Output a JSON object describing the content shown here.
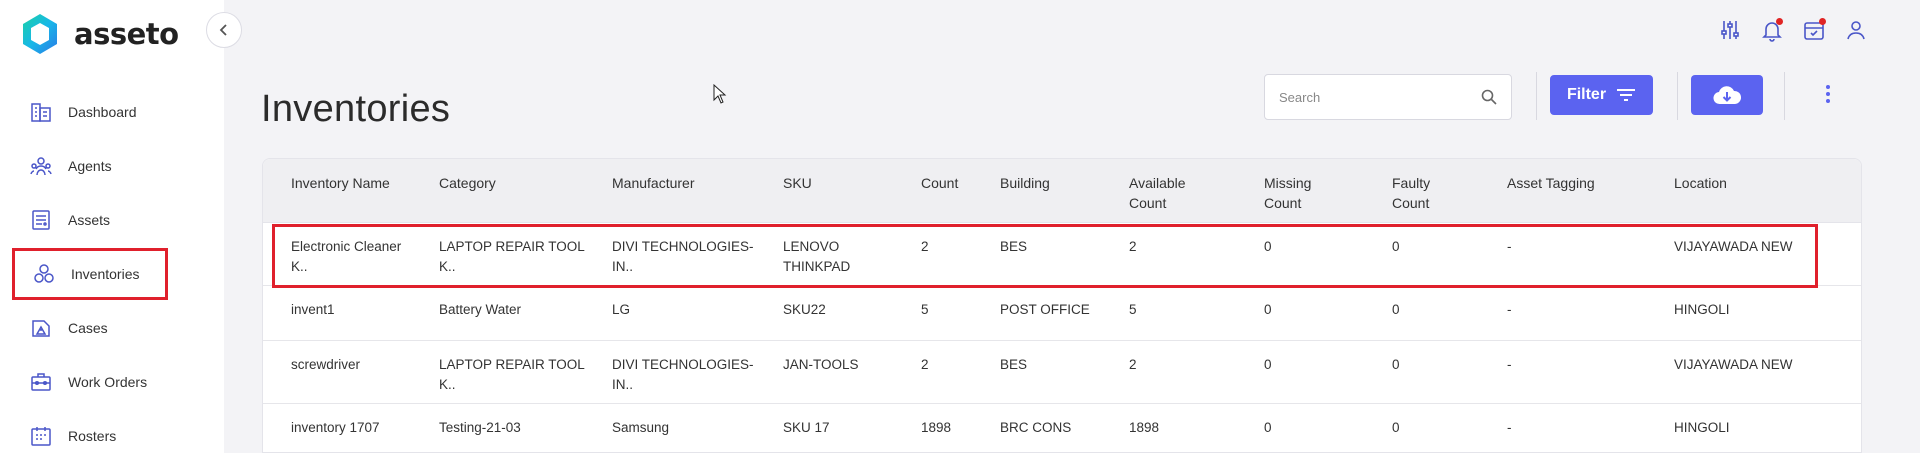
{
  "app": {
    "name": "asseto"
  },
  "sidebar": {
    "items": [
      {
        "label": "Dashboard",
        "icon": "dashboard-icon"
      },
      {
        "label": "Agents",
        "icon": "agents-icon"
      },
      {
        "label": "Assets",
        "icon": "assets-icon"
      },
      {
        "label": "Inventories",
        "icon": "inventories-icon",
        "active": true
      },
      {
        "label": "Cases",
        "icon": "cases-icon"
      },
      {
        "label": "Work Orders",
        "icon": "work-orders-icon"
      },
      {
        "label": "Rosters",
        "icon": "rosters-icon"
      }
    ]
  },
  "header": {
    "icons": [
      "sliders-icon",
      "bell-icon",
      "calendar-check-icon",
      "user-icon"
    ]
  },
  "page": {
    "title": "Inventories",
    "search_placeholder": "Search",
    "filter_label": "Filter"
  },
  "colors": {
    "accent": "#5b63f0",
    "highlight": "#e0202c",
    "badge": "#e02424"
  },
  "table": {
    "headers": [
      [
        "Inventory Name"
      ],
      [
        "Category"
      ],
      [
        "Manufacturer"
      ],
      [
        "SKU"
      ],
      [
        "Count"
      ],
      [
        "Building"
      ],
      [
        "Available",
        "Count"
      ],
      [
        "Missing",
        "Count"
      ],
      [
        "Faulty",
        "Count"
      ],
      [
        "Asset Tagging"
      ],
      [
        "Location"
      ]
    ],
    "rows": [
      [
        [
          "Electronic Cleaner",
          "K.."
        ],
        [
          "LAPTOP REPAIR TOOL",
          "K.."
        ],
        [
          "DIVI TECHNOLOGIES-",
          "IN.."
        ],
        [
          "LENOVO",
          "THINKPAD"
        ],
        [
          "2"
        ],
        [
          "BES"
        ],
        [
          "2"
        ],
        [
          "0"
        ],
        [
          "0"
        ],
        [
          "-"
        ],
        [
          "VIJAYAWADA NEW"
        ]
      ],
      [
        [
          "invent1"
        ],
        [
          "Battery Water"
        ],
        [
          "LG"
        ],
        [
          "SKU22"
        ],
        [
          "5"
        ],
        [
          "POST OFFICE"
        ],
        [
          "5"
        ],
        [
          "0"
        ],
        [
          "0"
        ],
        [
          "-"
        ],
        [
          "HINGOLI"
        ]
      ],
      [
        [
          "screwdriver"
        ],
        [
          "LAPTOP REPAIR TOOL",
          "K.."
        ],
        [
          "DIVI TECHNOLOGIES-",
          "IN.."
        ],
        [
          "JAN-TOOLS"
        ],
        [
          "2"
        ],
        [
          "BES"
        ],
        [
          "2"
        ],
        [
          "0"
        ],
        [
          "0"
        ],
        [
          "-"
        ],
        [
          "VIJAYAWADA NEW"
        ]
      ],
      [
        [
          "inventory 1707"
        ],
        [
          "Testing-21-03"
        ],
        [
          "Samsung"
        ],
        [
          "SKU 17"
        ],
        [
          "1898"
        ],
        [
          "BRC CONS"
        ],
        [
          "1898"
        ],
        [
          "0"
        ],
        [
          "0"
        ],
        [
          "-"
        ],
        [
          "HINGOLI"
        ]
      ]
    ]
  }
}
